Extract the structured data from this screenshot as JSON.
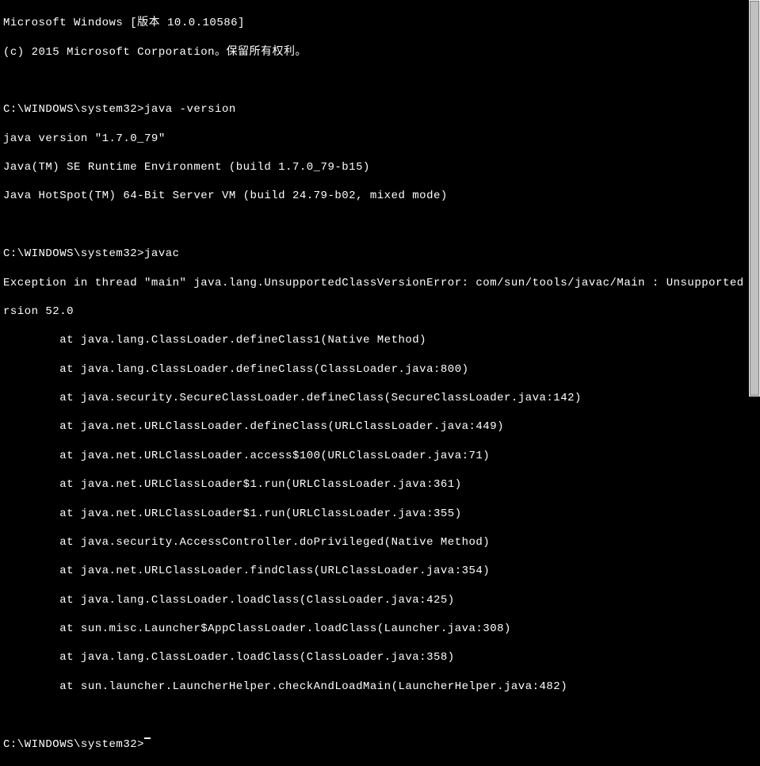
{
  "header": {
    "line1": "Microsoft Windows [版本 10.0.10586]",
    "line2": "(c) 2015 Microsoft Corporation。保留所有权利。"
  },
  "block1": {
    "prompt": "C:\\WINDOWS\\system32>",
    "command": "java -version",
    "out1": "java version \"1.7.0_79\"",
    "out2": "Java(TM) SE Runtime Environment (build 1.7.0_79-b15)",
    "out3": "Java HotSpot(TM) 64-Bit Server VM (build 24.79-b02, mixed mode)"
  },
  "block2": {
    "prompt": "C:\\WINDOWS\\system32>",
    "command": "javac",
    "err1": "Exception in thread \"main\" java.lang.UnsupportedClassVersionError: com/sun/tools/javac/Main : Unsupported major.minor ve",
    "err2": "rsion 52.0",
    "trace": [
      "        at java.lang.ClassLoader.defineClass1(Native Method)",
      "        at java.lang.ClassLoader.defineClass(ClassLoader.java:800)",
      "        at java.security.SecureClassLoader.defineClass(SecureClassLoader.java:142)",
      "        at java.net.URLClassLoader.defineClass(URLClassLoader.java:449)",
      "        at java.net.URLClassLoader.access$100(URLClassLoader.java:71)",
      "        at java.net.URLClassLoader$1.run(URLClassLoader.java:361)",
      "        at java.net.URLClassLoader$1.run(URLClassLoader.java:355)",
      "        at java.security.AccessController.doPrivileged(Native Method)",
      "        at java.net.URLClassLoader.findClass(URLClassLoader.java:354)",
      "        at java.lang.ClassLoader.loadClass(ClassLoader.java:425)",
      "        at sun.misc.Launcher$AppClassLoader.loadClass(Launcher.java:308)",
      "        at java.lang.ClassLoader.loadClass(ClassLoader.java:358)",
      "        at sun.launcher.LauncherHelper.checkAndLoadMain(LauncherHelper.java:482)"
    ]
  },
  "block3": {
    "prompt": "C:\\WINDOWS\\system32>"
  }
}
